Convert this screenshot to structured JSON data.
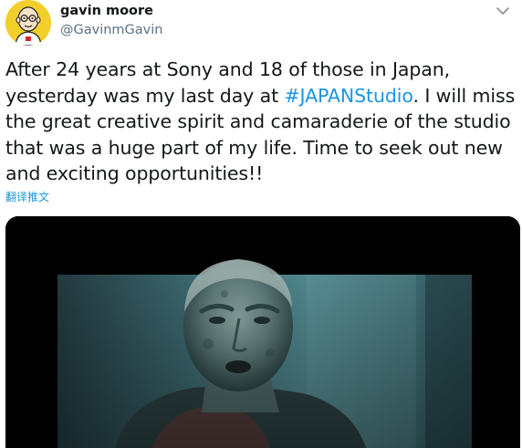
{
  "tweet": {
    "author": {
      "display_name": "gavin moore",
      "handle": "@GavinmGavin",
      "avatar_icon": "cartoon-avatar-icon"
    },
    "more_icon": "chevron-down-icon",
    "text_before": "After 24 years at Sony and 18 of those in Japan, yesterday was my last day at ",
    "hashtag": "#JAPANStudio",
    "text_after": ".  I will miss the great creative spirit and camaraderie of the studio that was a huge part of my life. Time to seek out new and exciting opportunities!!",
    "translate_label": "翻译推文",
    "media": {
      "type": "video-thumbnail"
    }
  },
  "colors": {
    "text": "#14171a",
    "secondary": "#5b7083",
    "link": "#1b95e0",
    "avatar_bg": "#f3cf2c"
  }
}
